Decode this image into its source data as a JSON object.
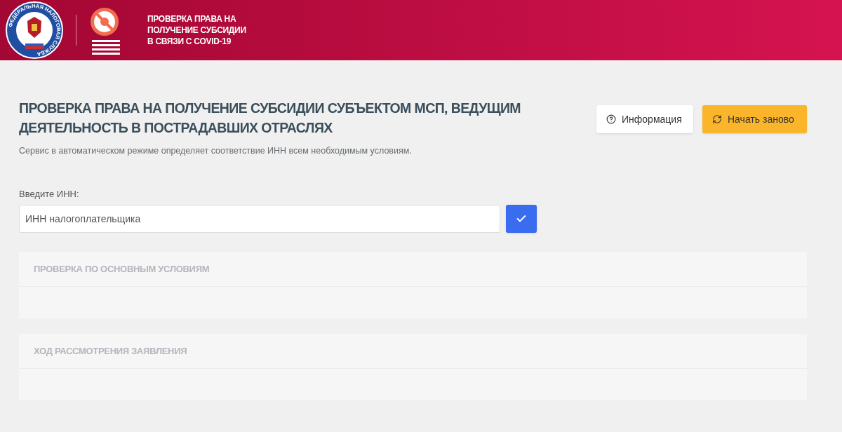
{
  "header": {
    "logo_text": "ФЕДЕРАЛЬНАЯ НАЛОГОВАЯ СЛУЖБА",
    "title_lines": [
      "ПРОВЕРКА ПРАВА НА",
      "ПОЛУЧЕНИЕ СУБСИДИИ",
      "В СВЯЗИ С COVID-19"
    ]
  },
  "page": {
    "title": "ПРОВЕРКА ПРАВА НА ПОЛУЧЕНИЕ СУБСИДИИ СУБЪЕКТОМ МСП, ВЕДУЩИМ ДЕЯТЕЛЬНОСТЬ В ПОСТРАДАВШИХ ОТРАСЛЯХ",
    "subtitle": "Сервис в автоматическом режиме определяет соответствие ИНН всем необходимым условиям."
  },
  "buttons": [
    {
      "label": "Информация",
      "kind": "info"
    },
    {
      "label": "Начать заново",
      "kind": "restart"
    }
  ],
  "inn": {
    "label": "Введите ИНН:",
    "placeholder": "ИНН налогоплательщика"
  },
  "panels": [
    {
      "title": "ПРОВЕРКА ПО ОСНОВНЫМ УСЛОВИЯМ"
    },
    {
      "title": "ХОД РАССМОТРЕНИЯ ЗАЯВЛЕНИЯ"
    }
  ]
}
